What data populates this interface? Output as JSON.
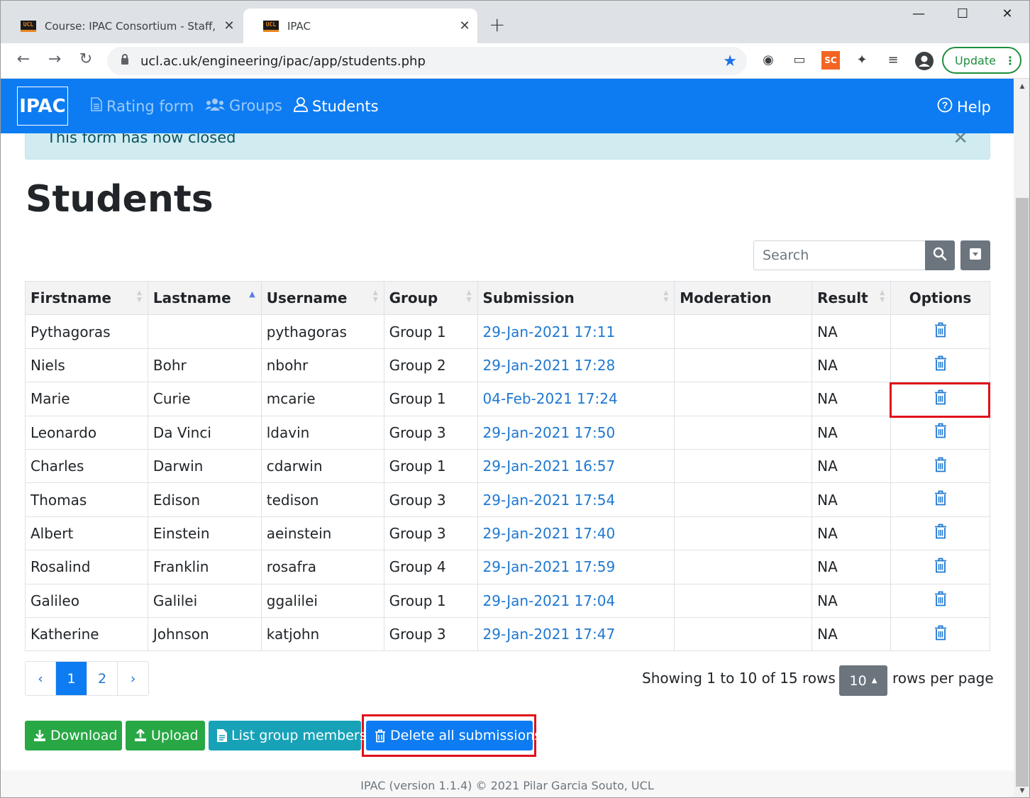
{
  "browser": {
    "tabs": [
      {
        "title": "Course: IPAC Consortium - Staff, T",
        "favicon": "UCL"
      },
      {
        "title": "IPAC",
        "favicon": "UCL"
      }
    ],
    "url": "ucl.ac.uk/engineering/ipac/app/students.php",
    "update_label": "Update"
  },
  "app": {
    "brand": "IPAC",
    "nav": {
      "rating_form": "Rating form",
      "groups": "Groups",
      "students": "Students",
      "help": "Help"
    },
    "alert": "This form has now closed",
    "page_title": "Students",
    "search_placeholder": "Search",
    "table": {
      "headers": [
        "Firstname",
        "Lastname",
        "Username",
        "Group",
        "Submission",
        "Moderation",
        "Result",
        "Options"
      ],
      "rows": [
        {
          "firstname": "Pythagoras",
          "lastname": "",
          "username": "pythagoras",
          "group": "Group 1",
          "submission": "29-Jan-2021 17:11",
          "moderation": "",
          "result": "NA"
        },
        {
          "firstname": "Niels",
          "lastname": "Bohr",
          "username": "nbohr",
          "group": "Group 2",
          "submission": "29-Jan-2021 17:28",
          "moderation": "",
          "result": "NA"
        },
        {
          "firstname": "Marie",
          "lastname": "Curie",
          "username": "mcarie",
          "group": "Group 1",
          "submission": "04-Feb-2021 17:24",
          "moderation": "",
          "result": "NA"
        },
        {
          "firstname": "Leonardo",
          "lastname": "Da Vinci",
          "username": "ldavin",
          "group": "Group 3",
          "submission": "29-Jan-2021 17:50",
          "moderation": "",
          "result": "NA"
        },
        {
          "firstname": "Charles",
          "lastname": "Darwin",
          "username": "cdarwin",
          "group": "Group 1",
          "submission": "29-Jan-2021 16:57",
          "moderation": "",
          "result": "NA"
        },
        {
          "firstname": "Thomas",
          "lastname": "Edison",
          "username": "tedison",
          "group": "Group 3",
          "submission": "29-Jan-2021 17:54",
          "moderation": "",
          "result": "NA"
        },
        {
          "firstname": "Albert",
          "lastname": "Einstein",
          "username": "aeinstein",
          "group": "Group 3",
          "submission": "29-Jan-2021 17:40",
          "moderation": "",
          "result": "NA"
        },
        {
          "firstname": "Rosalind",
          "lastname": "Franklin",
          "username": "rosafra",
          "group": "Group 4",
          "submission": "29-Jan-2021 17:59",
          "moderation": "",
          "result": "NA"
        },
        {
          "firstname": "Galileo",
          "lastname": "Galilei",
          "username": "ggalilei",
          "group": "Group 1",
          "submission": "29-Jan-2021 17:04",
          "moderation": "",
          "result": "NA"
        },
        {
          "firstname": "Katherine",
          "lastname": "Johnson",
          "username": "katjohn",
          "group": "Group 3",
          "submission": "29-Jan-2021 17:47",
          "moderation": "",
          "result": "NA"
        }
      ]
    },
    "pagination": {
      "prev": "‹",
      "pages": [
        "1",
        "2"
      ],
      "current": "1",
      "next": "›",
      "info": "Showing 1 to 10 of 15 rows",
      "rows_per_page": "10",
      "rows_label": "rows per page"
    },
    "buttons": {
      "download": "Download",
      "upload": "Upload",
      "list_group_members": "List group members",
      "delete_all": "Delete all submissions"
    },
    "footer": "IPAC (version 1.1.4) © 2021 Pilar Garcia Souto, UCL"
  },
  "colors": {
    "navbar": "#0d7cf2",
    "success": "#28a745",
    "info": "#17a2b8",
    "highlight": "#e0101b",
    "link": "#1f78d1"
  },
  "icons": [
    "close-icon",
    "plus-icon",
    "back-arrow-icon",
    "forward-arrow-icon",
    "reload-icon",
    "lock-icon",
    "star-icon",
    "profile-icon",
    "document-icon",
    "users-icon",
    "user-icon",
    "help-icon",
    "search-icon",
    "caret-down-icon",
    "trash-icon",
    "download-icon",
    "upload-icon",
    "file-icon"
  ]
}
